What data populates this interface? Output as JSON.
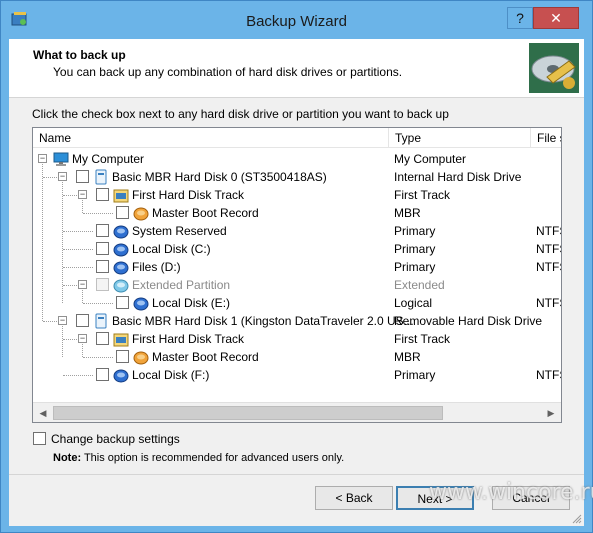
{
  "window": {
    "title": "Backup Wizard",
    "help_label": "?",
    "close_label": "✕"
  },
  "header": {
    "title": "What to back up",
    "subtitle": "You can back up any combination of hard disk drives or partitions."
  },
  "instruction": "Click the check box next to any hard disk drive or partition you want to back up",
  "columns": {
    "name": "Name",
    "type": "Type",
    "fs": "File s"
  },
  "rows": [
    {
      "label": "My Computer",
      "type": "My Computer",
      "fs": "",
      "icon": "computer-icon"
    },
    {
      "label": "Basic MBR Hard Disk 0 (ST3500418AS)",
      "type": "Internal Hard Disk Drive",
      "fs": "",
      "icon": "disk-icon"
    },
    {
      "label": "First Hard Disk Track",
      "type": "First Track",
      "fs": "",
      "icon": "track-icon"
    },
    {
      "label": "Master Boot Record",
      "type": "MBR",
      "fs": "",
      "icon": "mbr-icon"
    },
    {
      "label": "System Reserved",
      "type": "Primary",
      "fs": "NTFS",
      "icon": "partition-icon"
    },
    {
      "label": "Local Disk (C:)",
      "type": "Primary",
      "fs": "NTFS",
      "icon": "partition-icon"
    },
    {
      "label": "Files (D:)",
      "type": "Primary",
      "fs": "NTFS",
      "icon": "partition-icon"
    },
    {
      "label": "Extended Partition",
      "type": "Extended",
      "fs": "",
      "icon": "extended-partition-icon"
    },
    {
      "label": "Local Disk (E:)",
      "type": "Logical",
      "fs": "NTFS",
      "icon": "partition-icon"
    },
    {
      "label": "Basic MBR Hard Disk 1 (Kingston DataTraveler 2.0 US...",
      "type": "Removable Hard Disk Drive",
      "fs": "",
      "icon": "disk-icon"
    },
    {
      "label": "First Hard Disk Track",
      "type": "First Track",
      "fs": "",
      "icon": "track-icon"
    },
    {
      "label": "Master Boot Record",
      "type": "MBR",
      "fs": "",
      "icon": "mbr-icon"
    },
    {
      "label": "Local Disk (F:)",
      "type": "Primary",
      "fs": "NTFS",
      "icon": "partition-icon"
    }
  ],
  "options": {
    "change_settings_label": "Change backup settings",
    "note_bold": "Note:",
    "note_text": " This option is recommended for advanced users only."
  },
  "buttons": {
    "back": "< Back",
    "next": "Next >",
    "cancel": "Cancel"
  },
  "watermark": "www.wincore.ru"
}
